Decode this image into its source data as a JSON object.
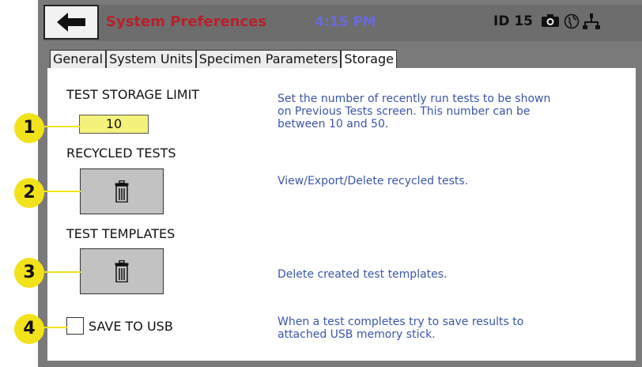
{
  "header": {
    "title": "System Preferences",
    "time": "4:15 PM",
    "id_label": "ID 15"
  },
  "tabs": [
    {
      "label": "General"
    },
    {
      "label": "System Units"
    },
    {
      "label": "Specimen Parameters"
    },
    {
      "label": "Storage"
    }
  ],
  "storage": {
    "limit_label": "TEST STORAGE LIMIT",
    "limit_value": "10",
    "limit_desc_1": "Set the number of recently run tests to be shown",
    "limit_desc_2": "on Previous Tests screen. This number can be",
    "limit_desc_3": "between 10 and 50.",
    "recycled_label": "RECYCLED TESTS",
    "recycled_desc": "View/Export/Delete recycled tests.",
    "templates_label": "TEST TEMPLATES",
    "templates_desc": "Delete created test templates.",
    "usb_label": "SAVE TO USB",
    "usb_checked": false,
    "usb_desc_1": "When a test completes try to save results to",
    "usb_desc_2": "attached USB memory stick."
  },
  "callouts": [
    "1",
    "2",
    "3",
    "4"
  ],
  "colors": {
    "title": "#b8202a",
    "time": "#6a6adb",
    "description": "#3b56a8",
    "callout": "#f2e21a",
    "input_bg": "#f5f27c"
  },
  "icons": [
    "back-arrow-icon",
    "camera-icon",
    "globe-icon",
    "network-icon",
    "trash-icon"
  ]
}
